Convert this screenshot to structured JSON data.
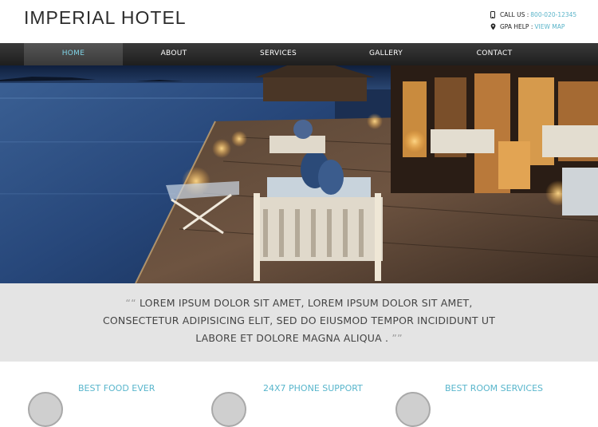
{
  "brand": {
    "name": "IMPERIAL HOTEL"
  },
  "contact": {
    "call": {
      "label": "CALL US :",
      "value": "800-020-12345"
    },
    "gpa": {
      "label": "GPA HELP :",
      "value": "VIEW MAP"
    }
  },
  "nav": {
    "items": [
      {
        "label": "HOME",
        "active": true
      },
      {
        "label": "ABOUT",
        "active": false
      },
      {
        "label": "SERVICES",
        "active": false
      },
      {
        "label": "GALLERY",
        "active": false
      },
      {
        "label": "CONTACT",
        "active": false
      }
    ]
  },
  "quote": {
    "open_mark": "““",
    "text": "LOREM IPSUM DOLOR SIT AMET, LOREM IPSUM DOLOR SIT AMET, CONSECTETUR ADIPISICING ELIT, SED DO EIUSMOD TEMPOR INCIDIDUNT UT LABORE ET DOLORE MAGNA ALIQUA .",
    "close_mark": "””"
  },
  "features": [
    {
      "title": "BEST FOOD EVER"
    },
    {
      "title": "24X7 PHONE SUPPORT"
    },
    {
      "title": "BEST ROOM SERVICES"
    }
  ],
  "colors": {
    "accent": "#5ab4c9",
    "nav_bg": "#2a2a2a",
    "nav_active_text": "#7fd3e6",
    "quote_bg": "#e4e4e4"
  }
}
